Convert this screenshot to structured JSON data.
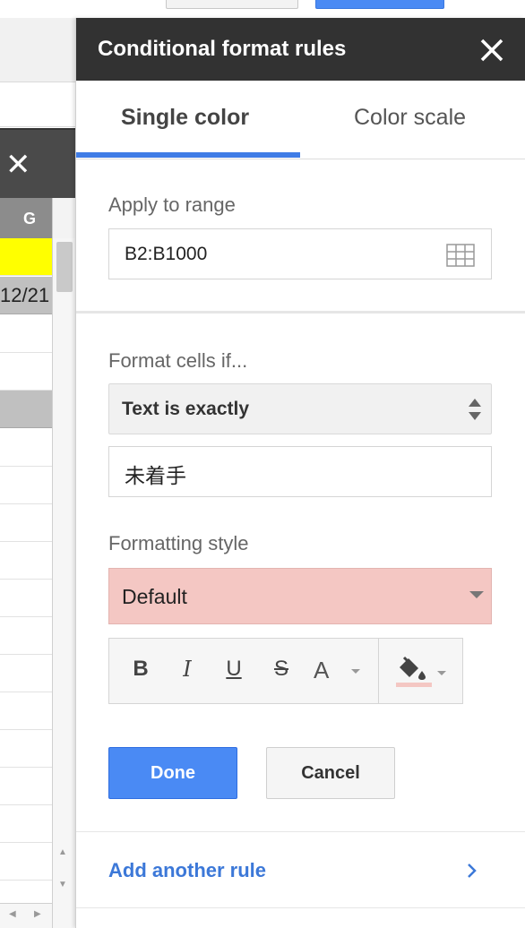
{
  "sheet": {
    "column_header": "G",
    "cell_date_fragment": "12/21"
  },
  "panel": {
    "title": "Conditional format rules",
    "tabs": [
      {
        "label": "Single color",
        "active": true
      },
      {
        "label": "Color scale",
        "active": false
      }
    ],
    "apply_range": {
      "label": "Apply to range",
      "value": "B2:B1000"
    },
    "condition": {
      "label": "Format cells if...",
      "selected": "Text is exactly",
      "value": "未着手"
    },
    "formatting": {
      "label": "Formatting style",
      "selected": "Default",
      "preview_color": "#f4c7c3",
      "bold_label": "B",
      "italic_label": "I",
      "underline_label": "U",
      "strike_label": "S",
      "text_color_label": "A"
    },
    "buttons": {
      "done": "Done",
      "cancel": "Cancel"
    },
    "add_rule": "Add another rule"
  },
  "colors": {
    "header_bg": "#323232",
    "accent": "#3f7ce6",
    "done_bg": "#4a8af4",
    "link": "#3c78d8",
    "highlight_yellow": "#ffff00"
  }
}
